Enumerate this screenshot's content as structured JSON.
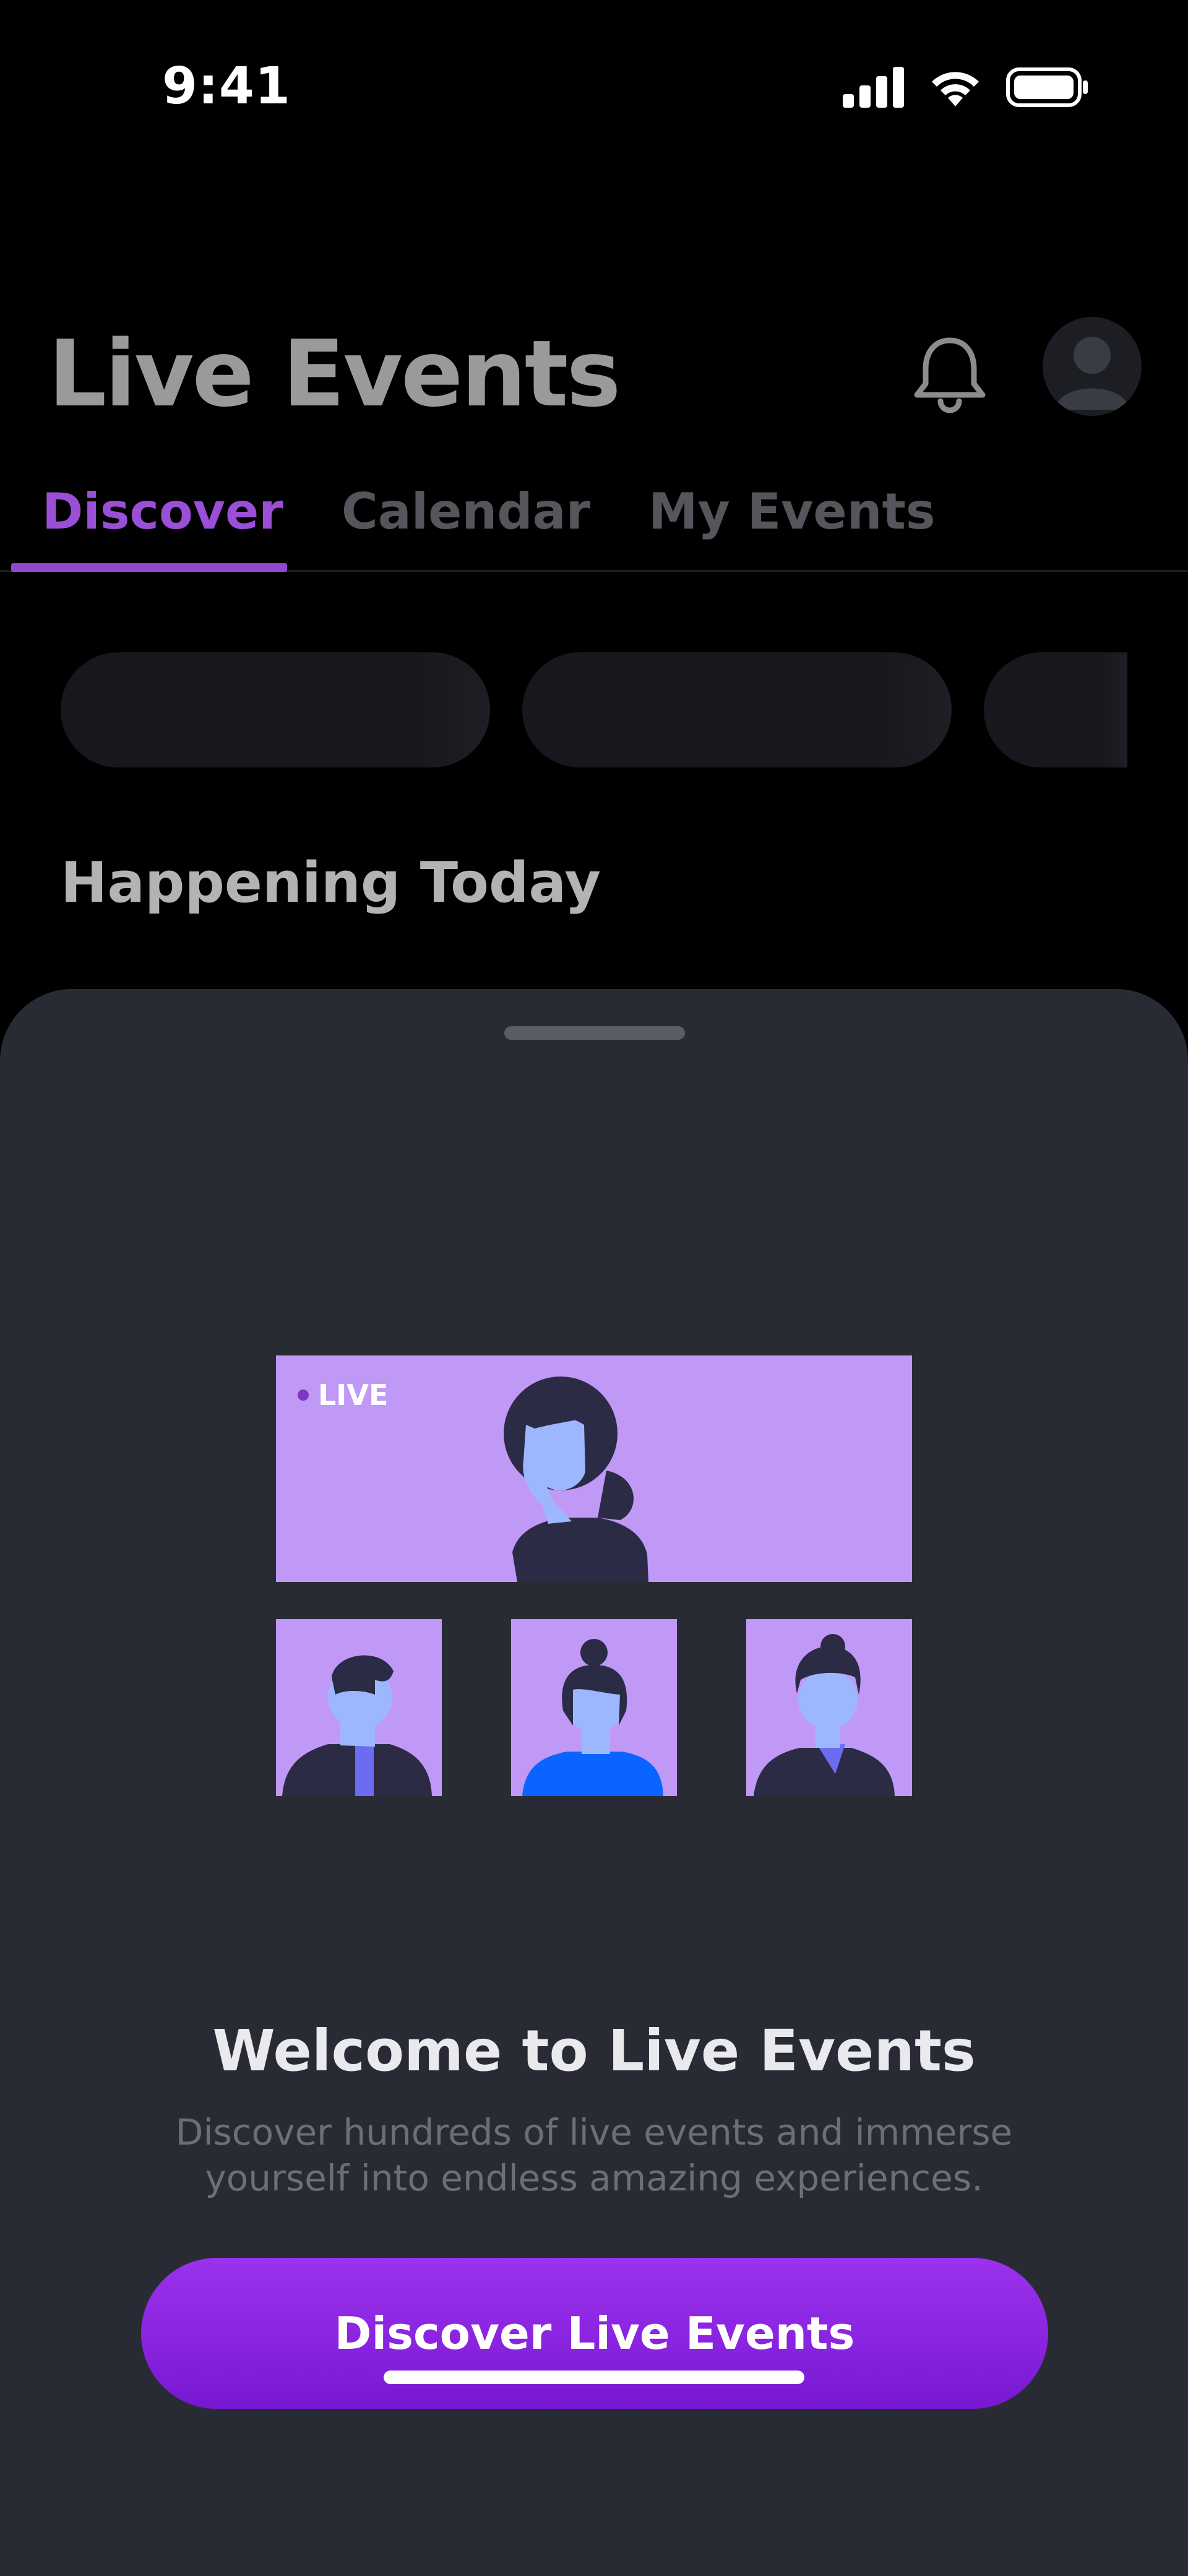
{
  "status_bar": {
    "time": "9:41",
    "signal_icon": "cellular-signal-icon",
    "wifi_icon": "wifi-icon",
    "battery_icon": "battery-icon"
  },
  "header": {
    "title": "Live Events",
    "bell_icon": "bell-icon",
    "avatar_icon": "profile-avatar-icon"
  },
  "tabs": [
    {
      "label": "Discover",
      "active": true
    },
    {
      "label": "Calendar",
      "active": false
    },
    {
      "label": "My Events",
      "active": false
    }
  ],
  "section": {
    "title": "Happening Today"
  },
  "sheet": {
    "illustration": {
      "live_label": "LIVE"
    },
    "title": "Welcome to Live Events",
    "description": "Discover hundreds of live events and immerse yourself into endless amazing experiences.",
    "cta_label": "Discover Live Events"
  },
  "colors": {
    "accent": "#9b4fd6",
    "cta": "#8a24e0",
    "sheet_bg": "#292b34",
    "illustration_bg": "#c099f6"
  }
}
